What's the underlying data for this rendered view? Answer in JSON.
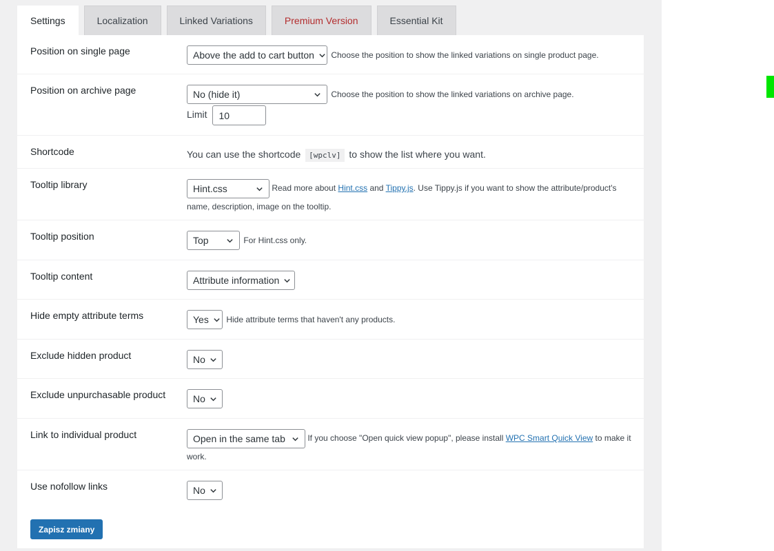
{
  "tabs": [
    {
      "label": "Settings",
      "active": true
    },
    {
      "label": "Localization",
      "active": false
    },
    {
      "label": "Linked Variations",
      "active": false
    },
    {
      "label": "Premium Version",
      "active": false
    },
    {
      "label": "Essential Kit",
      "active": false
    }
  ],
  "settings": {
    "single_page": {
      "label": "Position on single page",
      "value": "Above the add to cart button",
      "description": "Choose the position to show the linked variations on single product page."
    },
    "archive_page": {
      "label": "Position on archive page",
      "value": "No (hide it)",
      "description": "Choose the position to show the linked variations on archive page.",
      "limit_label": "Limit",
      "limit_value": "10"
    },
    "shortcode": {
      "label": "Shortcode",
      "text_before": "You can use the shortcode",
      "code": "[wpclv]",
      "text_after": "to show the list where you want."
    },
    "tooltip_library": {
      "label": "Tooltip library",
      "value": "Hint.css",
      "desc_prefix": "Read more about",
      "link_hint": "Hint.css",
      "desc_and": "and",
      "link_tippy": "Tippy.js",
      "desc_suffix": ". Use Tippy.js if you want to show the attribute/product's name, description, image on the tooltip."
    },
    "tooltip_position": {
      "label": "Tooltip position",
      "value": "Top",
      "description": "For Hint.css only."
    },
    "tooltip_content": {
      "label": "Tooltip content",
      "value": "Attribute information"
    },
    "hide_empty": {
      "label": "Hide empty attribute terms",
      "value": "Yes",
      "description": "Hide attribute terms that haven't any products."
    },
    "exclude_hidden": {
      "label": "Exclude hidden product",
      "value": "No"
    },
    "exclude_unpurchasable": {
      "label": "Exclude unpurchasable product",
      "value": "No"
    },
    "link_individual": {
      "label": "Link to individual product",
      "value": "Open in the same tab",
      "desc_prefix": "If you choose \"Open quick view popup\", please install",
      "link_text": "WPC Smart Quick View",
      "desc_suffix": "to make it work."
    },
    "nofollow": {
      "label": "Use nofollow links",
      "value": "No"
    }
  },
  "save_label": "Zapisz zmiany",
  "colors": {
    "accent": "#2271b1",
    "premium": "#b32d2e",
    "indicator": "#00e600"
  }
}
